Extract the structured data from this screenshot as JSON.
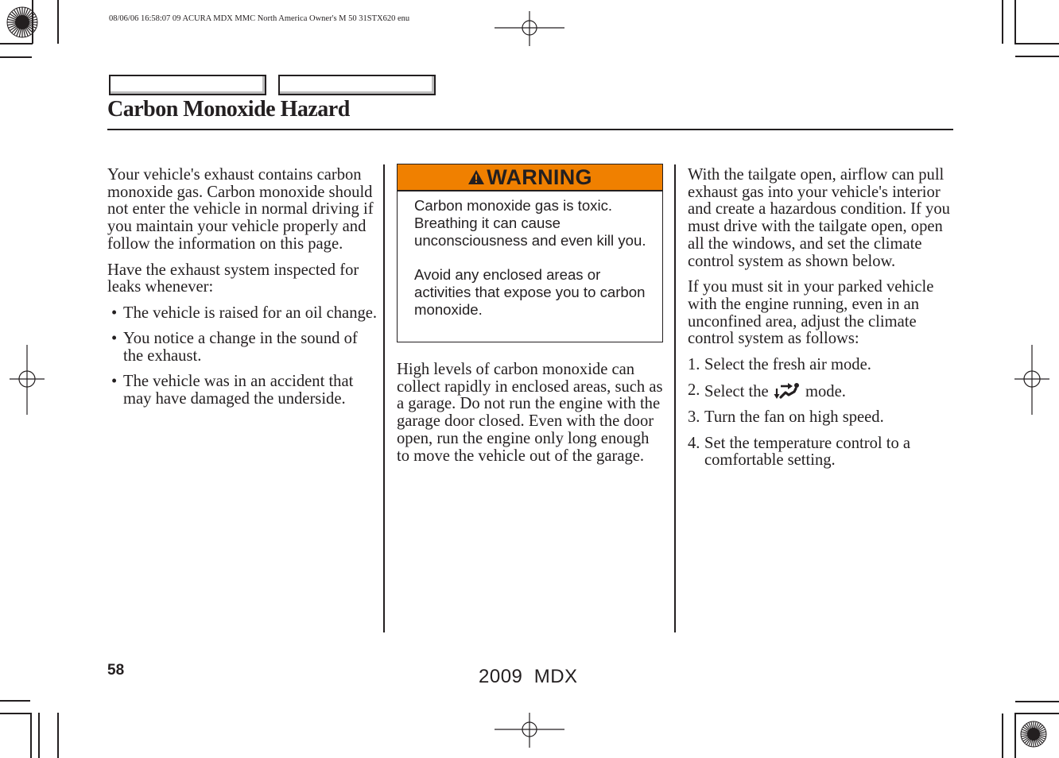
{
  "print_header": "08/06/06 16:58:07    09 ACURA MDX MMC North America Owner's M 50 31STX620 enu",
  "nav_tabs": [
    {
      "label": ""
    },
    {
      "label": ""
    }
  ],
  "page_title": "Carbon Monoxide Hazard",
  "left_column": {
    "paragraphs": [
      "Your vehicle's exhaust contains carbon monoxide gas. Carbon monoxide should not enter the vehicle in normal driving if you maintain your vehicle properly and follow the information on this page.",
      "Have the exhaust system inspected for leaks whenever:"
    ],
    "bullets": [
      "The vehicle is raised for an oil change.",
      "You notice a change in the sound of the exhaust.",
      "The vehicle was in an accident that may have damaged the underside."
    ],
    "bullet_glyph": "•"
  },
  "warning": {
    "icon": "warning-triangle-icon",
    "title": "WARNING",
    "color": "#f08000",
    "paragraphs": [
      "Carbon monoxide gas is toxic. Breathing it can cause unconsciousness and even kill you.",
      "Avoid any enclosed areas or activities that expose you to carbon monoxide."
    ]
  },
  "middle_column": {
    "paragraph": "High levels of carbon monoxide can collect rapidly in enclosed areas, such as a garage. Do not run the engine with the garage door closed. Even with the door open, run the engine only long enough to move the vehicle out of the garage."
  },
  "right_column": {
    "paragraphs": [
      "With the tailgate open, airflow can pull exhaust gas into your vehicle's interior and create a hazardous condition. If you must drive with the tailgate open, open all the windows, and set the climate control system as shown below.",
      "If you must sit in your parked vehicle with the engine running, even in an unconfined area, adjust the climate control system as follows:"
    ],
    "steps": [
      {
        "num": "1.",
        "text": "Select the fresh air mode."
      },
      {
        "num": "2.",
        "text_before": "Select the",
        "icon": "floor-defrost-mode-icon",
        "text_after": "mode."
      },
      {
        "num": "3.",
        "text": "Turn the fan on high speed."
      },
      {
        "num": "4.",
        "text": "Set the temperature control to a comfortable setting."
      }
    ]
  },
  "footer": {
    "page_number": "58",
    "model": "2009  MDX"
  }
}
